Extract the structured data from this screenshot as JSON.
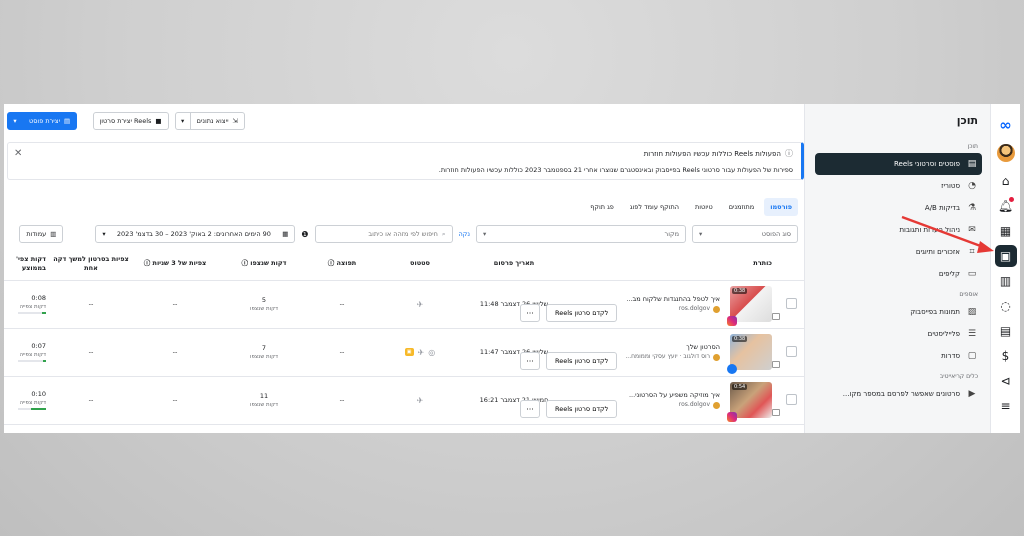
{
  "nav": {
    "title": "תוכן",
    "section_content": "תוכן",
    "items_content": [
      {
        "label": "פוסטים וסרטוני Reels",
        "icon": "video-grid-icon",
        "active": true
      },
      {
        "label": "סטוריז",
        "icon": "story-icon"
      },
      {
        "label": "בדיקות A/B",
        "icon": "flask-icon"
      },
      {
        "label": "ניהול הערות ותגובות",
        "icon": "mail-icon"
      },
      {
        "label": "אזכורים ותיוגים",
        "icon": "tag-icon"
      },
      {
        "label": "קליפים",
        "icon": "clips-icon"
      }
    ],
    "section_assets": "אוספים",
    "items_assets": [
      {
        "label": "תמונות בפייסבוק",
        "icon": "image-icon"
      },
      {
        "label": "פלייליסטים",
        "icon": "playlist-icon"
      },
      {
        "label": "סדרות",
        "icon": "series-icon"
      }
    ],
    "section_creative": "כלים קריאייטיב",
    "items_creative": [
      {
        "label": "סרטונים שאפשר לפרסם במספר מקו...",
        "icon": "play-box-icon"
      }
    ]
  },
  "toolbar": {
    "create_post": "יצירת פוסט",
    "create_reel": "יצירת סרטון Reels",
    "export": "ייצוא נתונים"
  },
  "banner": {
    "title": "הפעולות Reels כוללות עכשיו הפעולות חוזרות",
    "body": "ספירות של הפעולות עבור סרטוני Reels בפייסבוק ובאינסטגרם שנוצרו אחרי 21 בספטמבר 2023 כוללות עכשיו הפעולות חוזרות."
  },
  "tabs": [
    {
      "label": "פורסמו",
      "active": true
    },
    {
      "label": "מתוזמנים"
    },
    {
      "label": "טיוטות"
    },
    {
      "label": "התוקף עומד לפוג"
    },
    {
      "label": "פג תוקף"
    }
  ],
  "filters": {
    "post_type": "סוג הפוסט",
    "source": "מקור",
    "clear": "נקה",
    "search_placeholder": "חיפוש לפי מזהה או כיתוב",
    "date_range": "90 הימים האחרונים: 2 באוק' 2023 – 30 בדצמ' 2023",
    "columns": "עמודות"
  },
  "table": {
    "headers": {
      "title": "כותרת",
      "date": "תאריך פרסום",
      "status": "סטטוס",
      "reach": "תפוצה",
      "minutes": "דקות שנצפו",
      "views3s": "צפיות של 3 שניות",
      "views1m": "צפיות בסרטון למשך דקה אחת",
      "avg": "דקות צפי' בממוצע"
    },
    "boost_label": "לקדם סרטון Reels",
    "more_label": "···",
    "rows": [
      {
        "title": "איך לטפל בהתנגדות שלקוח מב...",
        "account": "ros.dolgov",
        "duration": "0:38",
        "network": "instagram",
        "date": "שלישי 26 דצמבר 11:48",
        "reach": "--",
        "minutes": "5",
        "minutes_sub": "דקות שנצפו",
        "views3s": "--",
        "views1m": "--",
        "avg": "0:08",
        "avg_sub": "דקות צפייה",
        "avg_pct": 0.15
      },
      {
        "title": "הסרטון שלך",
        "account": "רוס דולגוב · יועץ עסקי וממומח...",
        "duration": "0:38",
        "network": "facebook",
        "date": "שלישי 26 דצמבר 11:47",
        "reach": "--",
        "minutes": "7",
        "minutes_sub": "דקות שנצפו",
        "views3s": "--",
        "views1m": "--",
        "avg": "0:07",
        "avg_sub": "דקות צפייה",
        "avg_pct": 0.12
      },
      {
        "title": "איך מוזיקה משפיע על הסרטוני...",
        "account": "ros.dolgov",
        "duration": "0:54",
        "network": "instagram",
        "date": "חמישי 21 דצמבר 16:21",
        "reach": "--",
        "minutes": "11",
        "minutes_sub": "דקות שנצפו",
        "views3s": "--",
        "views1m": "--",
        "avg": "0:10",
        "avg_sub": "דקות צפייה",
        "avg_pct": 0.55
      }
    ]
  },
  "colors": {
    "accent": "#1877f2",
    "active_nav": "#1c2b33",
    "arrow": "#e53935"
  }
}
